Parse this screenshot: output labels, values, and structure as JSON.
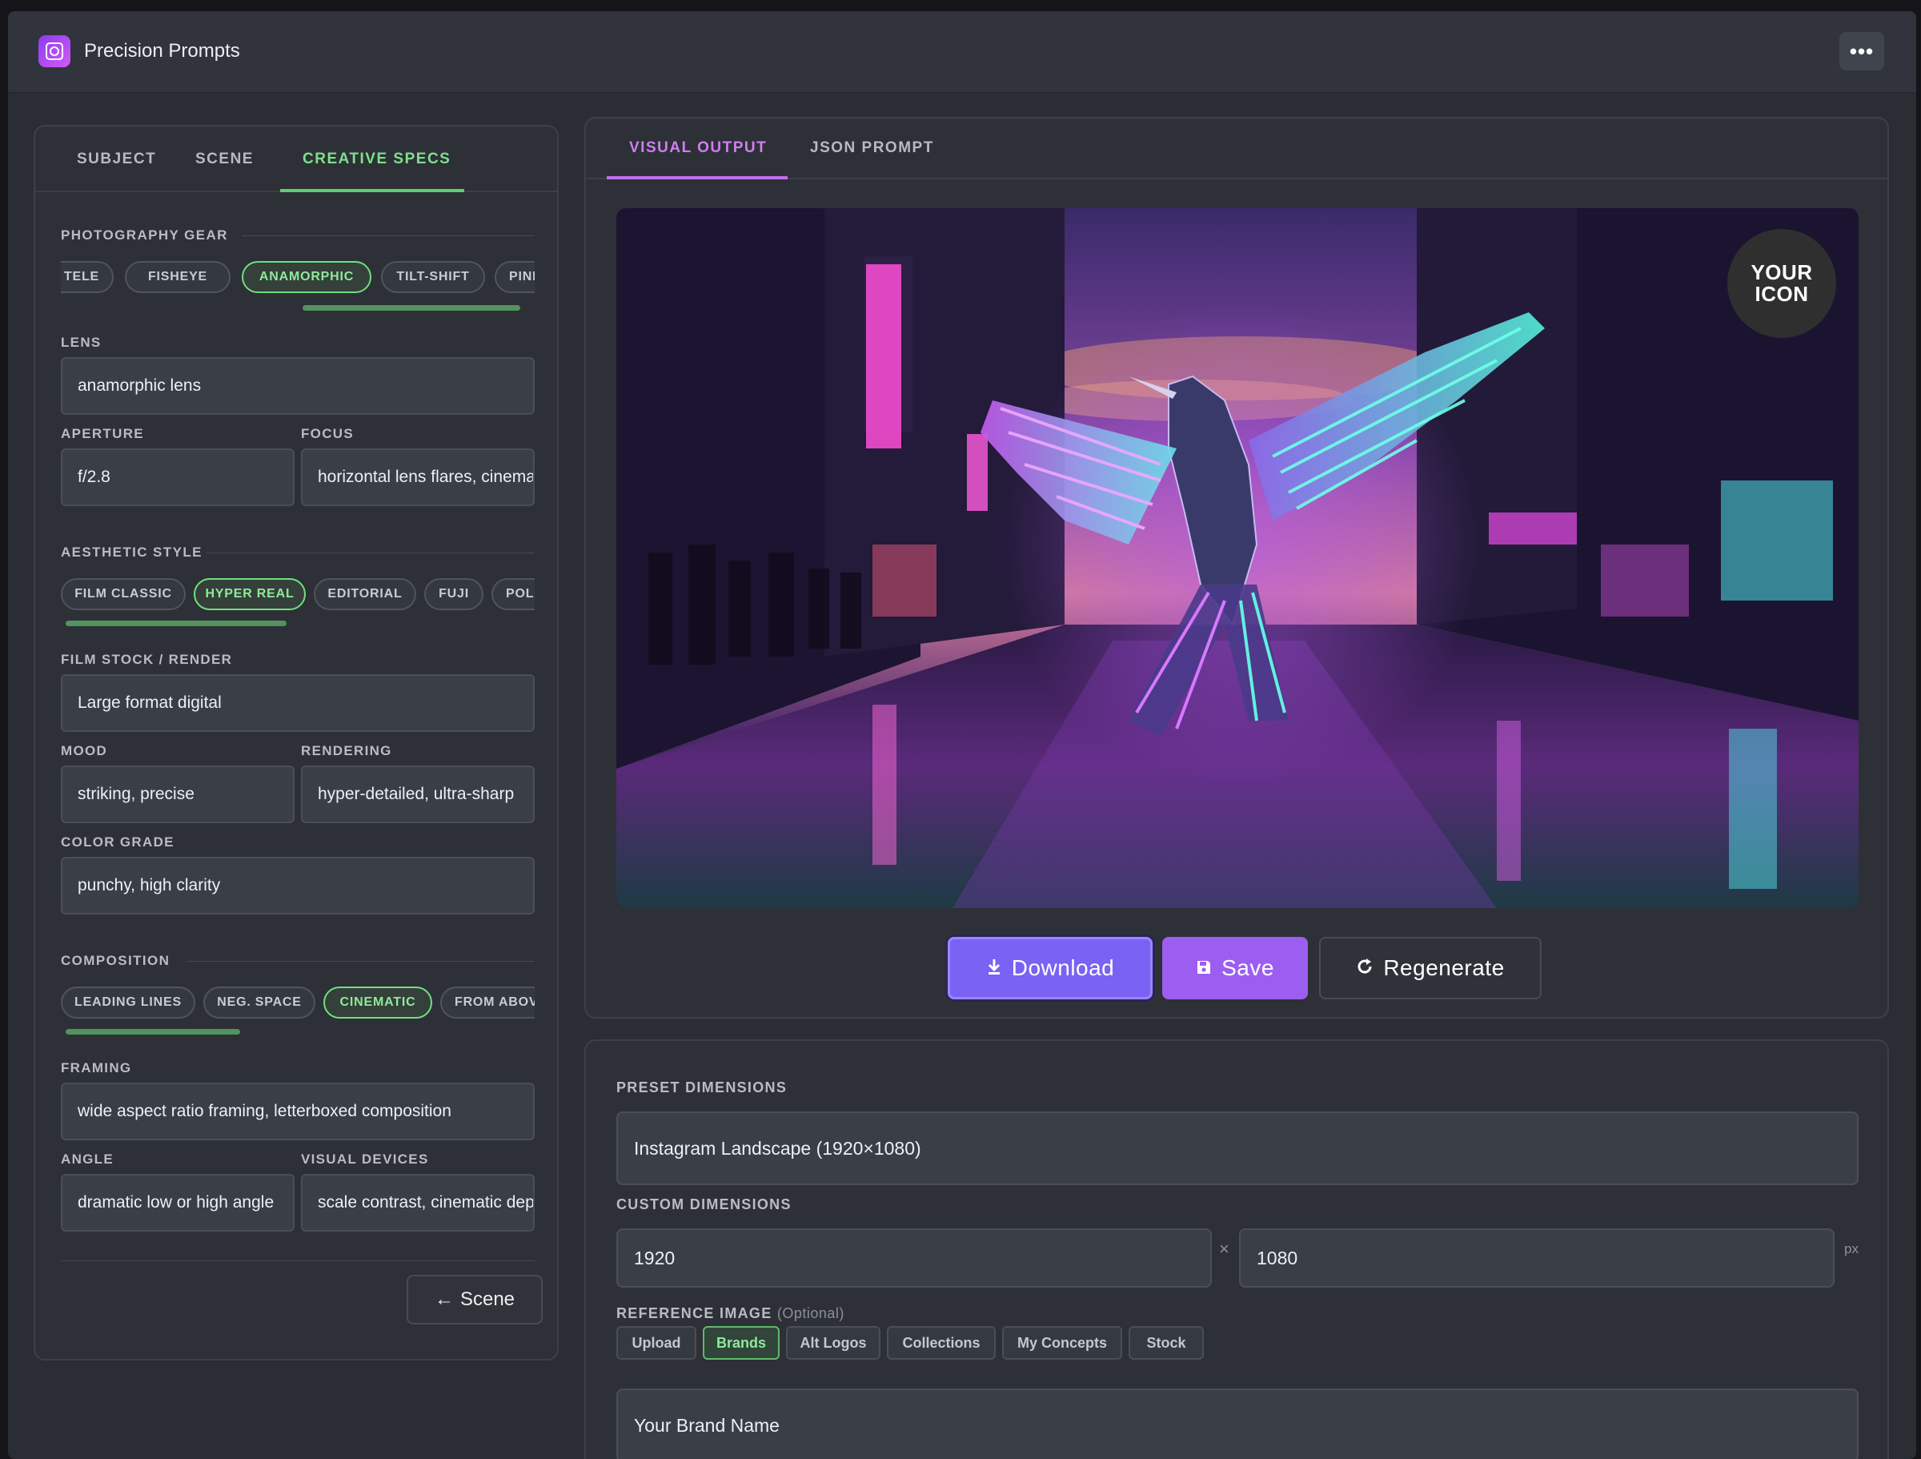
{
  "app": {
    "title": "Precision Prompts",
    "logo_icon": "camera-app-icon",
    "menu_icon": "more-icon"
  },
  "left": {
    "tabs": [
      {
        "label": "SUBJECT",
        "active": false
      },
      {
        "label": "SCENE",
        "active": false
      },
      {
        "label": "CREATIVE SPECS",
        "active": true
      }
    ],
    "gear": {
      "title": "PHOTOGRAPHY GEAR",
      "chips": [
        {
          "label": "TELE",
          "active": false
        },
        {
          "label": "FISHEYE",
          "active": false
        },
        {
          "label": "ANAMORPHIC",
          "active": true
        },
        {
          "label": "TILT-SHIFT",
          "active": false
        },
        {
          "label": "PINHOLE",
          "active": false
        }
      ],
      "lens_label": "LENS",
      "lens_value": "anamorphic lens",
      "aperture_label": "APERTURE",
      "aperture_value": "f/2.8",
      "focus_label": "FOCUS",
      "focus_value": "horizontal lens flares, cinematic bokeh"
    },
    "aesthetic": {
      "title": "AESTHETIC STYLE",
      "chips": [
        {
          "label": "FILM CLASSIC",
          "active": false
        },
        {
          "label": "HYPER REAL",
          "active": true
        },
        {
          "label": "EDITORIAL",
          "active": false
        },
        {
          "label": "FUJI",
          "active": false
        },
        {
          "label": "POLAROID",
          "active": false
        }
      ],
      "film_label": "FILM STOCK / RENDER",
      "film_value": "Large format digital",
      "mood_label": "MOOD",
      "mood_value": "striking, precise",
      "rendering_label": "RENDERING",
      "rendering_value": "hyper-detailed, ultra-sharp",
      "grade_label": "COLOR GRADE",
      "grade_value": "punchy, high clarity"
    },
    "composition": {
      "title": "COMPOSITION",
      "chips": [
        {
          "label": "LEADING LINES",
          "active": false
        },
        {
          "label": "NEG. SPACE",
          "active": false
        },
        {
          "label": "CINEMATIC",
          "active": true
        },
        {
          "label": "FROM ABOVE",
          "active": false
        }
      ],
      "framing_label": "FRAMING",
      "framing_value": "wide aspect ratio framing, letterboxed composition",
      "angle_label": "ANGLE",
      "angle_value": "dramatic low or high angle",
      "devices_label": "VISUAL DEVICES",
      "devices_value": "scale contrast, cinematic depth"
    },
    "back_button": {
      "arrow": "←",
      "label": "Scene"
    }
  },
  "right": {
    "tabs": [
      {
        "label": "VISUAL OUTPUT",
        "active": true
      },
      {
        "label": "JSON PROMPT",
        "active": false
      }
    ],
    "badge": {
      "line1": "YOUR",
      "line2": "ICON"
    },
    "buttons": {
      "download": {
        "label": "Download",
        "icon": "download-icon"
      },
      "save": {
        "label": "Save",
        "icon": "save-icon"
      },
      "regenerate": {
        "label": "Regenerate",
        "icon": "refresh-icon"
      }
    }
  },
  "dims": {
    "preset_label": "PRESET DIMENSIONS",
    "preset_value": "Instagram Landscape (1920×1080)",
    "custom_label": "CUSTOM DIMENSIONS",
    "width_value": "1920",
    "times": "×",
    "height_value": "1080",
    "unit": "px",
    "ref_label": "REFERENCE IMAGE",
    "ref_optional": "(Optional)",
    "ref_tabs": [
      {
        "label": "Upload",
        "active": false
      },
      {
        "label": "Brands",
        "active": true
      },
      {
        "label": "Alt Logos",
        "active": false
      },
      {
        "label": "Collections",
        "active": false
      },
      {
        "label": "My Concepts",
        "active": false
      },
      {
        "label": "Stock",
        "active": false
      }
    ],
    "brand_value": "Your Brand Name"
  },
  "colors": {
    "accent_green": "#6ee07f",
    "accent_purple": "#c46ef0",
    "download": "#7a62f4",
    "save": "#9c5ef0"
  }
}
